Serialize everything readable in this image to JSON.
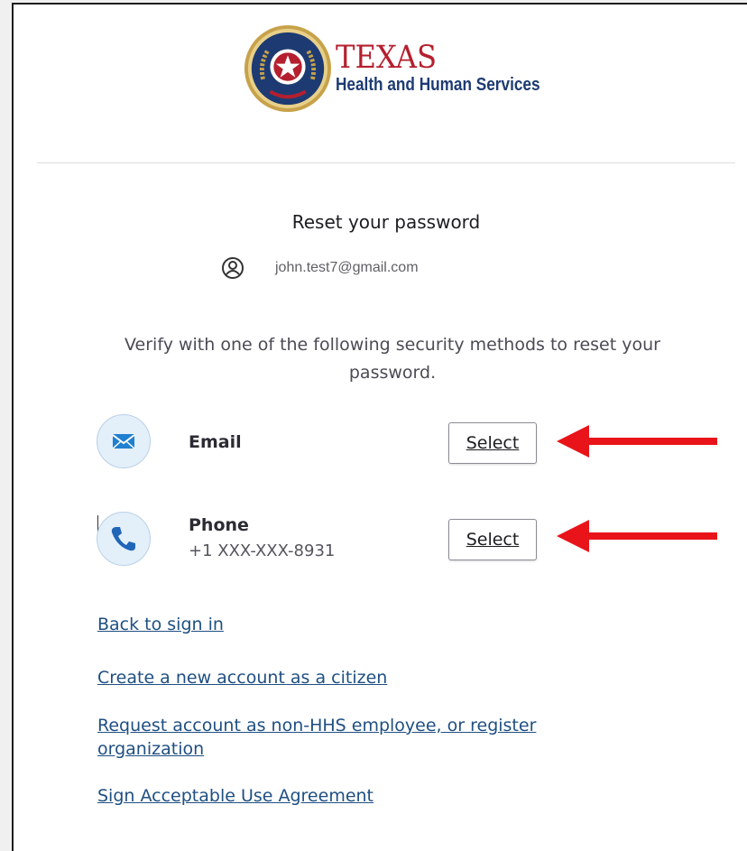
{
  "logo": {
    "title": "TEXAS",
    "subtitle": "Health and Human Services"
  },
  "page": {
    "title": "Reset your password"
  },
  "user": {
    "email": "john.test7@gmail.com",
    "icon": "user-circle-icon"
  },
  "instructions": "Verify with one of the following security methods to reset your password.",
  "methods": [
    {
      "label": "Email",
      "detail": "",
      "icon": "envelope-icon",
      "button": "Select"
    },
    {
      "label": "Phone",
      "detail": "+1 XXX-XXX-8931",
      "icon": "phone-icon",
      "button": "Select"
    }
  ],
  "links": {
    "back": "Back to sign in",
    "create": "Create a new account as a citizen",
    "request": "Request account as non-HHS employee, or register organization",
    "sign": "Sign Acceptable Use Agreement"
  },
  "colors": {
    "brand_red": "#b51f2e",
    "brand_blue": "#1d3b72",
    "link": "#1f4f82",
    "annotation_arrow": "#e8141a",
    "method_icon_bg": "#e3eff9"
  }
}
